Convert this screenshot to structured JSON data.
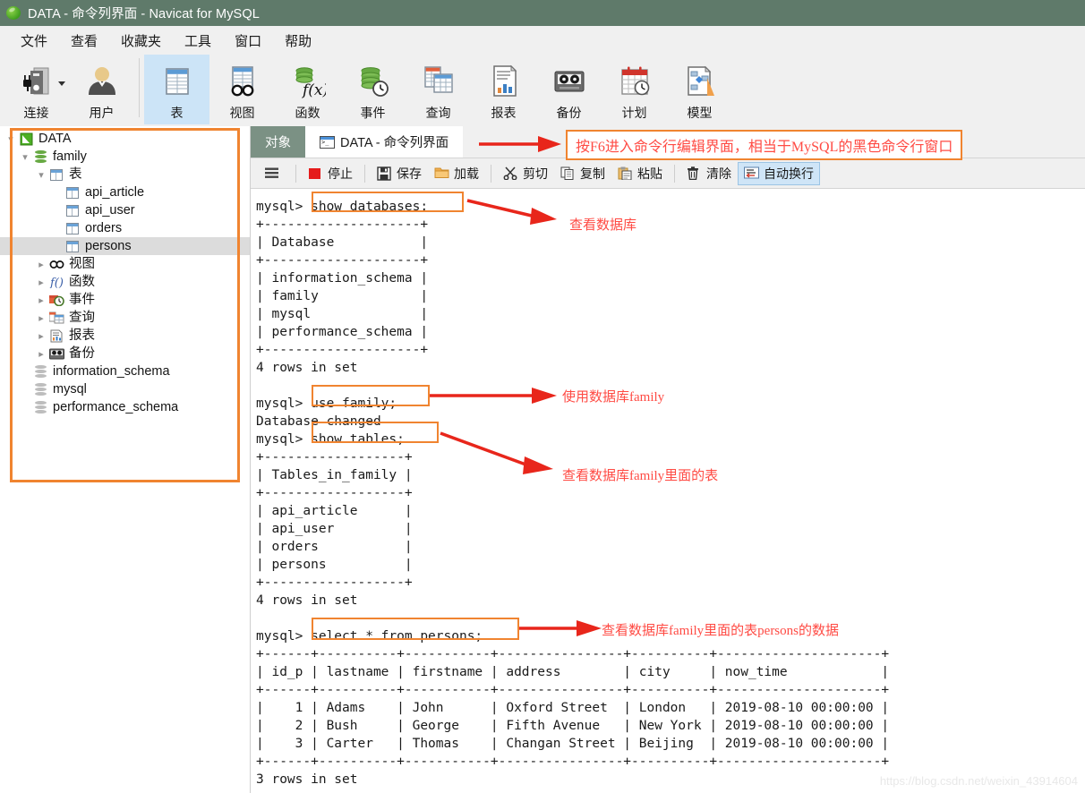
{
  "window": {
    "title": "DATA - 命令列界面 - Navicat for MySQL",
    "logo_icon": "navicat-leaf-logo"
  },
  "menubar": {
    "items": [
      {
        "label": "文件"
      },
      {
        "label": "查看"
      },
      {
        "label": "收藏夹"
      },
      {
        "label": "工具"
      },
      {
        "label": "窗口"
      },
      {
        "label": "帮助"
      }
    ]
  },
  "ribbon": {
    "items": [
      {
        "label": "连接",
        "icon": "connection-icon",
        "selected": false,
        "has_dropdown": true
      },
      {
        "label": "用户",
        "icon": "user-icon",
        "selected": false,
        "has_dropdown": false
      },
      {
        "label": "表",
        "icon": "table-icon",
        "selected": true,
        "has_dropdown": false
      },
      {
        "label": "视图",
        "icon": "view-icon",
        "selected": false,
        "has_dropdown": false
      },
      {
        "label": "函数",
        "icon": "function-icon",
        "selected": false,
        "has_dropdown": false
      },
      {
        "label": "事件",
        "icon": "event-icon",
        "selected": false,
        "has_dropdown": false
      },
      {
        "label": "查询",
        "icon": "query-icon",
        "selected": false,
        "has_dropdown": false
      },
      {
        "label": "报表",
        "icon": "report-icon",
        "selected": false,
        "has_dropdown": false
      },
      {
        "label": "备份",
        "icon": "backup-icon",
        "selected": false,
        "has_dropdown": false
      },
      {
        "label": "计划",
        "icon": "schedule-icon",
        "selected": false,
        "has_dropdown": false
      },
      {
        "label": "模型",
        "icon": "model-icon",
        "selected": false,
        "has_dropdown": false
      }
    ]
  },
  "sidebar": {
    "tree": [
      {
        "label": "DATA",
        "indent": 0,
        "chevron": "down",
        "icon": "navicat-connection-icon",
        "selected": false
      },
      {
        "label": "family",
        "indent": 1,
        "chevron": "down",
        "icon": "database-icon",
        "selected": false
      },
      {
        "label": "表",
        "indent": 2,
        "chevron": "down",
        "icon": "table-folder-icon",
        "selected": false
      },
      {
        "label": "api_article",
        "indent": 3,
        "chevron": "none",
        "icon": "table-icon",
        "selected": false
      },
      {
        "label": "api_user",
        "indent": 3,
        "chevron": "none",
        "icon": "table-icon",
        "selected": false
      },
      {
        "label": "orders",
        "indent": 3,
        "chevron": "none",
        "icon": "table-icon",
        "selected": false
      },
      {
        "label": "persons",
        "indent": 3,
        "chevron": "none",
        "icon": "table-icon",
        "selected": true
      },
      {
        "label": "视图",
        "indent": 2,
        "chevron": "right",
        "icon": "view-icon",
        "selected": false
      },
      {
        "label": "函数",
        "indent": 2,
        "chevron": "right",
        "icon": "function-icon",
        "selected": false
      },
      {
        "label": "事件",
        "indent": 2,
        "chevron": "right",
        "icon": "event-icon",
        "selected": false
      },
      {
        "label": "查询",
        "indent": 2,
        "chevron": "right",
        "icon": "query-icon",
        "selected": false
      },
      {
        "label": "报表",
        "indent": 2,
        "chevron": "right",
        "icon": "report-icon",
        "selected": false
      },
      {
        "label": "备份",
        "indent": 2,
        "chevron": "right",
        "icon": "backup-icon",
        "selected": false
      },
      {
        "label": "information_schema",
        "indent": 1,
        "chevron": "none",
        "icon": "database-gray-icon",
        "selected": false
      },
      {
        "label": "mysql",
        "indent": 1,
        "chevron": "none",
        "icon": "database-gray-icon",
        "selected": false
      },
      {
        "label": "performance_schema",
        "indent": 1,
        "chevron": "none",
        "icon": "database-gray-icon",
        "selected": false
      }
    ]
  },
  "tabs": [
    {
      "label": "对象",
      "active": false,
      "icon": "none"
    },
    {
      "label": "DATA - 命令列界面",
      "active": true,
      "icon": "console-icon"
    }
  ],
  "toolbar": {
    "menu_icon": "hamburger-icon",
    "buttons": [
      {
        "label": "停止",
        "icon": "stop-icon",
        "active": false
      },
      {
        "label": "保存",
        "icon": "save-icon",
        "active": false
      },
      {
        "label": "加载",
        "icon": "folder-icon",
        "active": false
      },
      {
        "label": "剪切",
        "icon": "scissors-icon",
        "active": false
      },
      {
        "label": "复制",
        "icon": "copy-icon",
        "active": false
      },
      {
        "label": "粘贴",
        "icon": "paste-icon",
        "active": false
      },
      {
        "label": "清除",
        "icon": "trash-icon",
        "active": false
      },
      {
        "label": "自动换行",
        "icon": "wordwrap-icon",
        "active": true
      }
    ]
  },
  "terminal": {
    "lines": [
      "mysql> show databases;",
      "+--------------------+",
      "| Database           |",
      "+--------------------+",
      "| information_schema |",
      "| family             |",
      "| mysql              |",
      "| performance_schema |",
      "+--------------------+",
      "4 rows in set",
      "",
      "mysql> use family;",
      "Database changed",
      "mysql> show tables;",
      "+------------------+",
      "| Tables_in_family |",
      "+------------------+",
      "| api_article      |",
      "| api_user         |",
      "| orders           |",
      "| persons          |",
      "+------------------+",
      "4 rows in set",
      "",
      "mysql> select * from persons;",
      "+------+----------+-----------+----------------+----------+---------------------+",
      "| id_p | lastname | firstname | address        | city     | now_time            |",
      "+------+----------+-----------+----------------+----------+---------------------+",
      "|    1 | Adams    | John      | Oxford Street  | London   | 2019-08-10 00:00:00 |",
      "|    2 | Bush     | George    | Fifth Avenue   | New York | 2019-08-10 00:00:00 |",
      "|    3 | Carter   | Thomas    | Changan Street | Beijing  | 2019-08-10 00:00:00 |",
      "+------+----------+-----------+----------------+----------+---------------------+",
      "3 rows in set"
    ]
  },
  "annotations": {
    "header_note": "按F6进入命令行编辑界面，相当于MySQL的黑色命令行窗口",
    "note_show_databases": "查看数据库",
    "note_use_family": "使用数据库family",
    "note_show_tables": "查看数据库family里面的表",
    "note_select_persons": "查看数据库family里面的表persons的数据"
  },
  "watermark": "https://blog.csdn.net/weixin_43914604",
  "colors": {
    "titlebar": "#5f7a6a",
    "accent_orange": "#f08430",
    "annotation_red": "#ff4b44",
    "selection_blue": "#cce4f7"
  }
}
